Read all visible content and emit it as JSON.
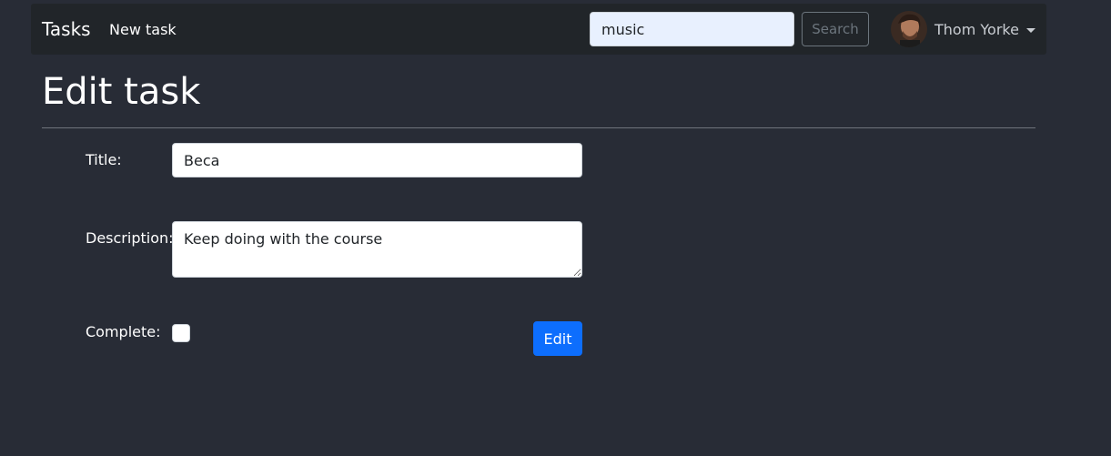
{
  "navbar": {
    "brand": "Tasks",
    "new_task_link": "New task",
    "search": {
      "value": "music",
      "button_label": "Search"
    },
    "user": {
      "name": "Thom Yorke",
      "avatar_icon": "user-avatar-icon"
    }
  },
  "page": {
    "title": "Edit task"
  },
  "form": {
    "title": {
      "label": "Title:",
      "value": "Beca"
    },
    "description": {
      "label": "Description:",
      "value": "Keep doing with the course"
    },
    "complete": {
      "label": "Complete:",
      "checked": false
    },
    "submit_label": "Edit"
  },
  "colors": {
    "background": "#282c36",
    "navbar": "#212529",
    "primary": "#0d6efd"
  }
}
